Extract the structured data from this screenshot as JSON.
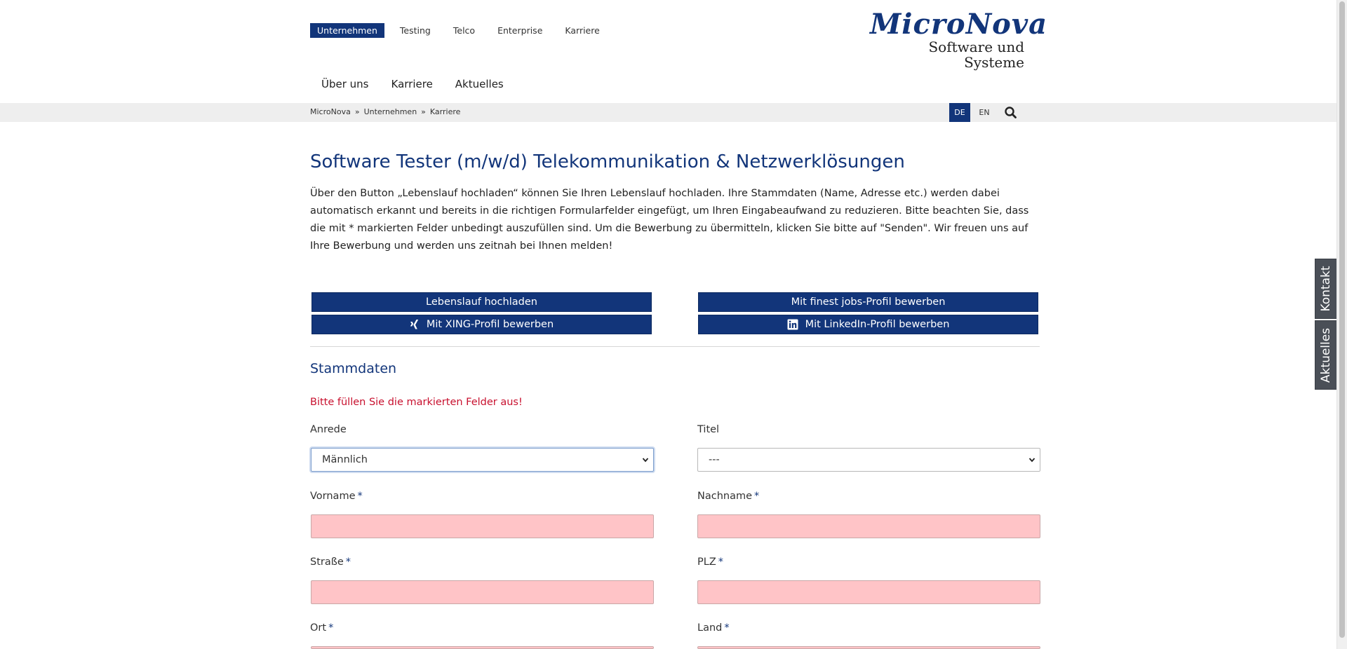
{
  "topnav": {
    "items": [
      {
        "label": "Unternehmen",
        "active": true
      },
      {
        "label": "Testing"
      },
      {
        "label": "Telco"
      },
      {
        "label": "Enterprise"
      },
      {
        "label": "Karriere"
      }
    ]
  },
  "logo": {
    "main": "MicroNova",
    "sub": "Software und Systeme"
  },
  "mainnav": {
    "items": [
      {
        "label": "Über uns"
      },
      {
        "label": "Karriere"
      },
      {
        "label": "Aktuelles"
      }
    ]
  },
  "breadcrumb": {
    "items": [
      "MicroNova",
      "Unternehmen",
      "Karriere"
    ],
    "separator": "»"
  },
  "lang": {
    "de": "DE",
    "en": "EN",
    "search_icon": "magnifier-icon"
  },
  "page": {
    "title": "Software Tester (m/w/d) Telekommunikation & Netzwerklösungen",
    "intro": "Über den Button „Lebenslauf hochladen“ können Sie Ihren Lebenslauf hochladen. Ihre Stammdaten (Name, Adresse etc.) werden dabei automatisch erkannt und bereits in die richtigen Formularfelder eingefügt, um Ihren Eingabeaufwand zu reduzieren. Bitte beachten Sie, dass die mit * markierten Felder unbedingt auszufüllen sind. Um die Bewerbung zu übermitteln, klicken Sie bitte auf \"Senden\". Wir freuen uns auf Ihre Bewerbung und werden uns zeitnah bei Ihnen melden!"
  },
  "actions": {
    "upload_cv": "Lebenslauf hochladen",
    "finest_jobs": "Mit finest jobs-Profil bewerben",
    "xing": "Mit XING-Profil bewerben",
    "linkedin": "Mit LinkedIn-Profil bewerben"
  },
  "form": {
    "section_title": "Stammdaten",
    "error": "Bitte füllen Sie die markierten Felder aus!",
    "required_mark": "*",
    "anrede": {
      "label": "Anrede",
      "value": "Männlich"
    },
    "titel": {
      "label": "Titel",
      "value": "---"
    },
    "vorname": {
      "label": "Vorname",
      "value": ""
    },
    "nachname": {
      "label": "Nachname",
      "value": ""
    },
    "strasse": {
      "label": "Straße",
      "value": ""
    },
    "plz": {
      "label": "PLZ",
      "value": ""
    },
    "ort": {
      "label": "Ort",
      "value": ""
    },
    "land": {
      "label": "Land",
      "value": ""
    }
  },
  "side_tabs": {
    "kontakt": "Kontakt",
    "aktuelles": "Aktuelles"
  },
  "colors": {
    "brand": "#12357a",
    "error": "#c8102e",
    "invalid_field": "#ffc4c7"
  }
}
